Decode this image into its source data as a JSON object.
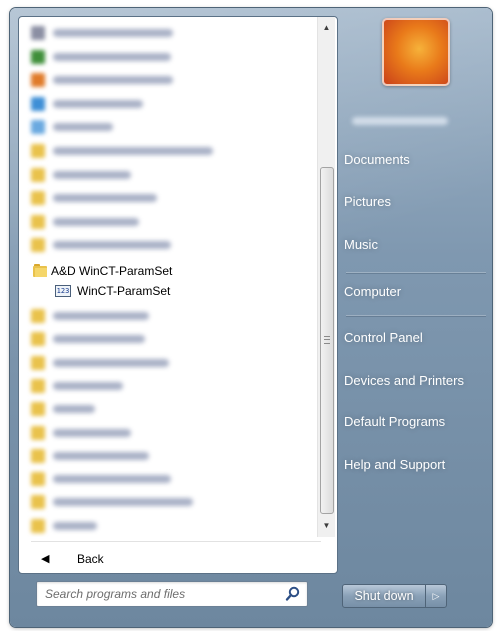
{
  "programs": {
    "blurred_top": [
      {
        "icon_color": "#8b8fa3",
        "text_width": 120
      },
      {
        "icon_color": "#3f8f3a",
        "text_width": 118
      },
      {
        "icon_color": "#e07b2a",
        "text_width": 120
      },
      {
        "icon_color": "#3e8fd6",
        "text_width": 90
      },
      {
        "icon_color": "#6aa9e0",
        "text_width": 60
      },
      {
        "icon_color": "#e9c24c",
        "text_width": 160
      },
      {
        "icon_color": "#e9c24c",
        "text_width": 78
      },
      {
        "icon_color": "#e9c24c",
        "text_width": 104
      },
      {
        "icon_color": "#e9c24c",
        "text_width": 86
      },
      {
        "icon_color": "#e9c24c",
        "text_width": 118
      }
    ],
    "folder_label": "A&D WinCT-ParamSet",
    "app_label": "WinCT-ParamSet",
    "app_icon_glyph": "123",
    "blurred_bottom": [
      {
        "icon_color": "#e9c24c",
        "text_width": 96
      },
      {
        "icon_color": "#e9c24c",
        "text_width": 92
      },
      {
        "icon_color": "#e9c24c",
        "text_width": 116
      },
      {
        "icon_color": "#e9c24c",
        "text_width": 70
      },
      {
        "icon_color": "#e9c24c",
        "text_width": 42
      },
      {
        "icon_color": "#e9c24c",
        "text_width": 78
      },
      {
        "icon_color": "#e9c24c",
        "text_width": 96
      },
      {
        "icon_color": "#e9c24c",
        "text_width": 118
      },
      {
        "icon_color": "#e9c24c",
        "text_width": 140
      },
      {
        "icon_color": "#e9c24c",
        "text_width": 44
      }
    ]
  },
  "back_label": "Back",
  "search": {
    "placeholder": "Search programs and files"
  },
  "right_pane": {
    "items": [
      {
        "name": "right-item-documents",
        "label": "Documents"
      },
      {
        "name": "right-item-pictures",
        "label": "Pictures"
      },
      {
        "name": "right-item-music",
        "label": "Music"
      },
      {
        "name": "right-item-computer",
        "label": "Computer"
      },
      {
        "name": "right-item-control-panel",
        "label": "Control Panel"
      },
      {
        "name": "right-item-devices-and-printers",
        "label": "Devices and Printers"
      },
      {
        "name": "right-item-default-programs",
        "label": "Default Programs"
      },
      {
        "name": "right-item-help-and-support",
        "label": "Help and Support"
      }
    ]
  },
  "shutdown": {
    "label": "Shut down",
    "arrow": "▷"
  },
  "colors": {
    "accent": "#7f98b0",
    "pane": "#ffffff",
    "text_light": "#ffffff"
  }
}
